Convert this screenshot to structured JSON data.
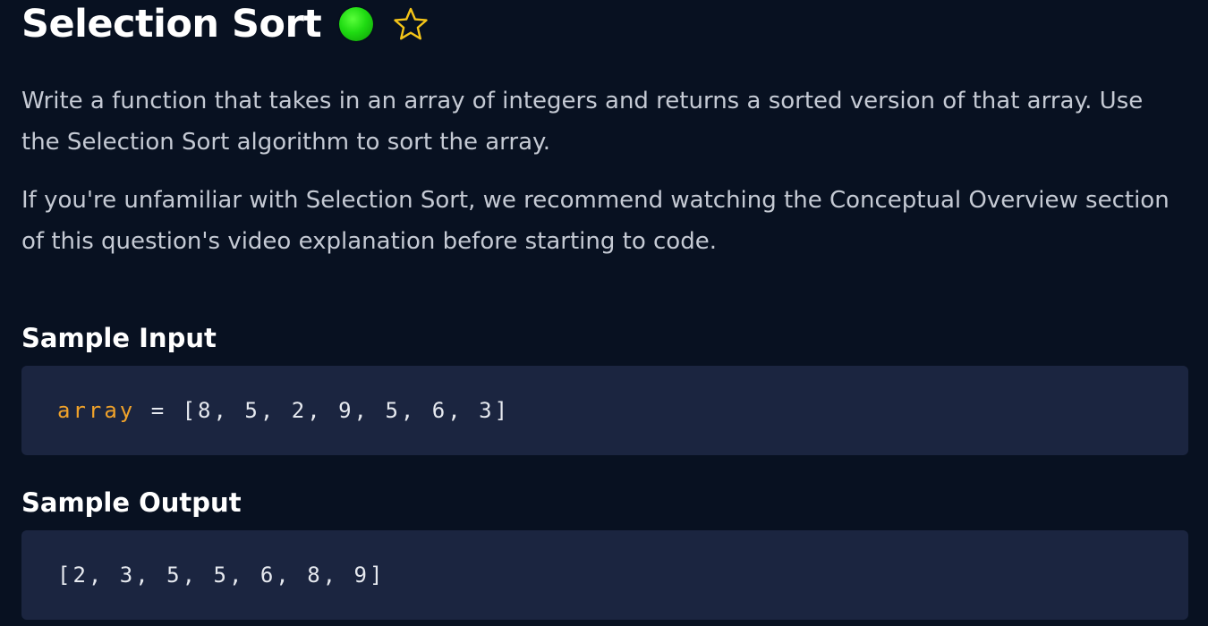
{
  "problem": {
    "title": "Selection Sort",
    "difficulty_color": "#22d414",
    "favorite_icon": "star-outline-icon",
    "star_color": "#f5c518",
    "description": [
      "Write a function that takes in an array of integers and returns a sorted version of that array. Use the Selection Sort algorithm to sort the array.",
      "If you're unfamiliar with Selection Sort, we recommend watching the Conceptual Overview section of this question's video explanation before starting to code."
    ]
  },
  "sample_input": {
    "heading": "Sample Input",
    "variable": "array",
    "operator": " = ",
    "value": "[8, 5, 2, 9, 5, 6, 3]",
    "variable_color": "#f0a22a"
  },
  "sample_output": {
    "heading": "Sample Output",
    "value": "[2, 3, 5, 5, 6, 8, 9]"
  }
}
